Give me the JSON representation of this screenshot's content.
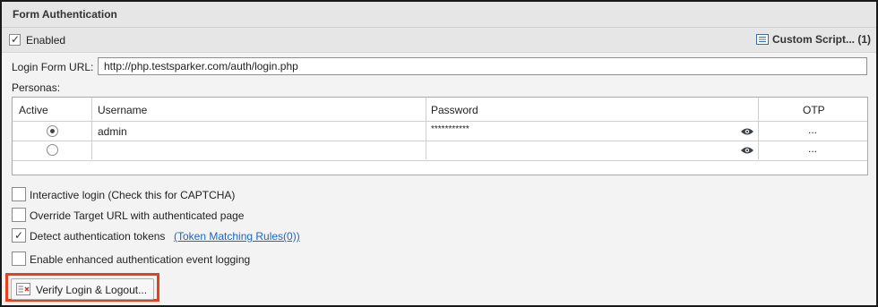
{
  "panel": {
    "title": "Form Authentication"
  },
  "enabled": {
    "label": "Enabled",
    "checked": true
  },
  "custom_script": {
    "icon": "document-list-icon",
    "label": "Custom Script... (1)"
  },
  "login_url": {
    "label": "Login Form URL:",
    "value": "http://php.testsparker.com/auth/login.php"
  },
  "personas": {
    "label": "Personas:",
    "columns": [
      "Active",
      "Username",
      "Password",
      "OTP"
    ],
    "rows": [
      {
        "active": true,
        "username": "admin",
        "password": "***********",
        "otp": "..."
      },
      {
        "active": false,
        "username": "",
        "password": "",
        "otp": "..."
      }
    ]
  },
  "options": {
    "interactive_login": {
      "label": "Interactive login (Check this for CAPTCHA)",
      "checked": false
    },
    "override_target": {
      "label": "Override Target URL with authenticated page",
      "checked": false
    },
    "detect_tokens": {
      "label": "Detect authentication tokens",
      "checked": true,
      "link": "(Token Matching Rules(0))"
    },
    "enhanced_logging": {
      "label": "Enable enhanced authentication event logging",
      "checked": false
    }
  },
  "verify_button": {
    "label": "Verify Login & Logout...",
    "icon": "verify-icon"
  },
  "colors": {
    "highlight": "#e8401c",
    "link": "#1d66c2"
  }
}
